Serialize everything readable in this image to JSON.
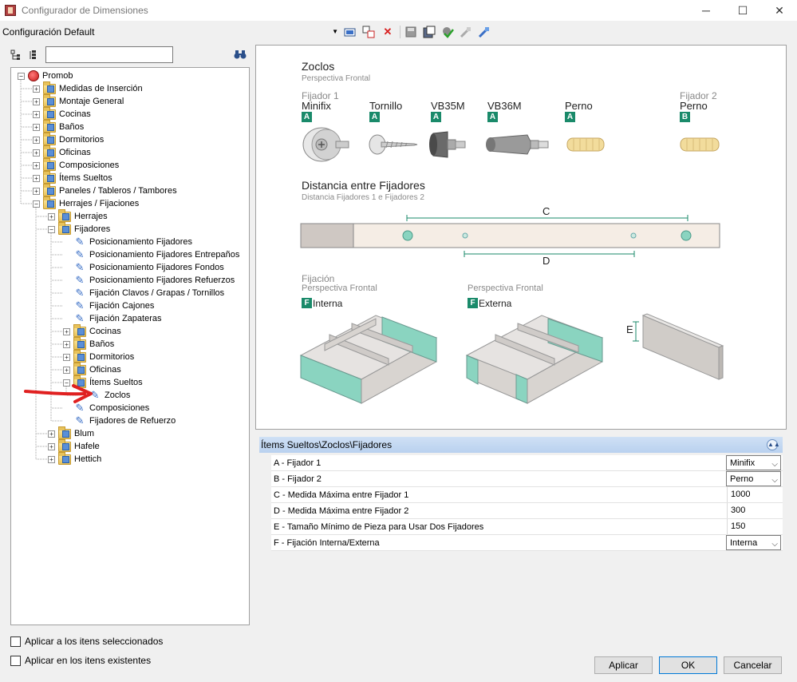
{
  "window": {
    "title": "Configurador de Dimensiones"
  },
  "toolbar": {
    "config_value": "Configuración Default"
  },
  "search": {
    "placeholder": ""
  },
  "tree": {
    "items": [
      {
        "label": "Promob",
        "level": 0,
        "exp": "−",
        "icon": "root"
      },
      {
        "label": "Medidas de Inserción",
        "level": 1,
        "exp": "+",
        "icon": "folder"
      },
      {
        "label": "Montaje General",
        "level": 1,
        "exp": "+",
        "icon": "folder"
      },
      {
        "label": "Cocinas",
        "level": 1,
        "exp": "+",
        "icon": "folder"
      },
      {
        "label": "Baños",
        "level": 1,
        "exp": "+",
        "icon": "folder"
      },
      {
        "label": "Dormitorios",
        "level": 1,
        "exp": "+",
        "icon": "folder"
      },
      {
        "label": "Oficinas",
        "level": 1,
        "exp": "+",
        "icon": "folder"
      },
      {
        "label": "Composiciones",
        "level": 1,
        "exp": "+",
        "icon": "folder"
      },
      {
        "label": "Ítems Sueltos",
        "level": 1,
        "exp": "+",
        "icon": "folder"
      },
      {
        "label": "Paneles / Tableros / Tambores",
        "level": 1,
        "exp": "+",
        "icon": "folder"
      },
      {
        "label": "Herrajes / Fijaciones",
        "level": 1,
        "exp": "−",
        "icon": "folder"
      },
      {
        "label": "Herrajes",
        "level": 2,
        "exp": "+",
        "icon": "folder"
      },
      {
        "label": "Fijadores",
        "level": 2,
        "exp": "−",
        "icon": "folder"
      },
      {
        "label": "Posicionamiento Fijadores",
        "level": 3,
        "exp": "",
        "icon": "leaf"
      },
      {
        "label": "Posicionamiento Fijadores Entrepaños",
        "level": 3,
        "exp": "",
        "icon": "leaf"
      },
      {
        "label": "Posicionamiento Fijadores Fondos",
        "level": 3,
        "exp": "",
        "icon": "leaf"
      },
      {
        "label": "Posicionamiento Fijadores Refuerzos",
        "level": 3,
        "exp": "",
        "icon": "leaf"
      },
      {
        "label": "Fijación Clavos / Grapas / Tornillos",
        "level": 3,
        "exp": "",
        "icon": "leaf"
      },
      {
        "label": "Fijación Cajones",
        "level": 3,
        "exp": "",
        "icon": "leaf"
      },
      {
        "label": "Fijación Zapateras",
        "level": 3,
        "exp": "",
        "icon": "leaf"
      },
      {
        "label": "Cocinas",
        "level": 3,
        "exp": "+",
        "icon": "folder"
      },
      {
        "label": "Baños",
        "level": 3,
        "exp": "+",
        "icon": "folder"
      },
      {
        "label": "Dormitorios",
        "level": 3,
        "exp": "+",
        "icon": "folder"
      },
      {
        "label": "Oficinas",
        "level": 3,
        "exp": "+",
        "icon": "folder"
      },
      {
        "label": "Ítems Sueltos",
        "level": 3,
        "exp": "−",
        "icon": "folder"
      },
      {
        "label": "Zoclos",
        "level": 4,
        "exp": "",
        "icon": "leaf"
      },
      {
        "label": "Composiciones",
        "level": 3,
        "exp": "",
        "icon": "leaf"
      },
      {
        "label": "Fijadores de Refuerzo",
        "level": 3,
        "exp": "",
        "icon": "leaf"
      },
      {
        "label": "Blum",
        "level": 2,
        "exp": "+",
        "icon": "folder"
      },
      {
        "label": "Hafele",
        "level": 2,
        "exp": "+",
        "icon": "folder"
      },
      {
        "label": "Hettich",
        "level": 2,
        "exp": "+",
        "icon": "folder"
      }
    ]
  },
  "checkboxes": {
    "apply_selected": "Aplicar a los itens seleccionados",
    "apply_existing": "Aplicar en los itens existentes"
  },
  "diagram": {
    "title": "Zoclos",
    "subtitle": "Perspectiva Frontal",
    "fijador1_caption": "Fijador 1",
    "fijador2_caption": "Fijador 2",
    "parts": [
      {
        "name": "Minifix",
        "badge": "A"
      },
      {
        "name": "Tornillo",
        "badge": "A"
      },
      {
        "name": "VB35M",
        "badge": "A"
      },
      {
        "name": "VB36M",
        "badge": "A"
      },
      {
        "name": "Perno",
        "badge": "A"
      },
      {
        "name": "Perno",
        "badge": "B"
      }
    ],
    "distance_title": "Distancia entre Fijadores",
    "distance_subtitle": "Distancia Fijadores 1 e Fijadores 2",
    "dim_c": "C",
    "dim_d": "D",
    "dim_e": "E",
    "fijacion_caption": "Fijación",
    "persp_left": "Perspectiva Frontal",
    "persp_right": "Perspectiva Frontal",
    "badge_f": "F",
    "interna": "Interna",
    "externa": "Externa"
  },
  "props": {
    "header": "Ítems Sueltos\\Zoclos\\Fijadores",
    "rows": [
      {
        "name": "A - Fijador 1",
        "value": "Minifix",
        "combo": true
      },
      {
        "name": "B - Fijador 2",
        "value": "Perno",
        "combo": true
      },
      {
        "name": "C - Medida Máxima entre Fijador 1",
        "value": "1000",
        "combo": false
      },
      {
        "name": "D - Medida Máxima entre Fijador 2",
        "value": "300",
        "combo": false
      },
      {
        "name": "E - Tamaño Mínimo de Pieza para Usar Dos Fijadores",
        "value": "150",
        "combo": false
      },
      {
        "name": "F - Fijación Interna/Externa",
        "value": "Interna",
        "combo": true
      }
    ]
  },
  "buttons": {
    "apply": "Aplicar",
    "ok": "OK",
    "cancel": "Cancelar"
  },
  "colors": {
    "accent": "#1a8a6a",
    "selection_header": "#c4d8f2",
    "arrow": "#e02020"
  }
}
